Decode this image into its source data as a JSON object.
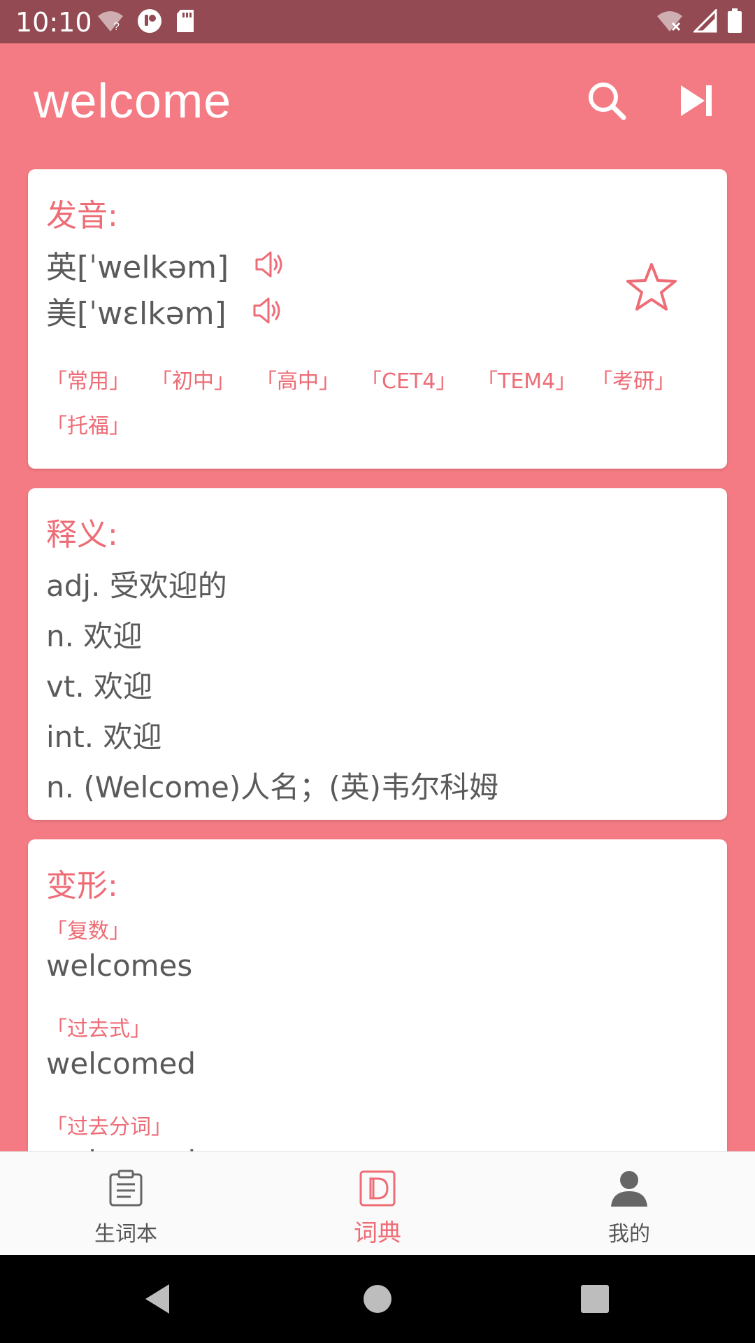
{
  "status_bar": {
    "time": "10:10"
  },
  "app_bar": {
    "title": "welcome",
    "search_icon": "search-icon",
    "next_icon": "skip-next-icon"
  },
  "pronunciation": {
    "title": "发音:",
    "uk": "英[ˈwelkəm]",
    "us": "美[ˈwɛlkəm]",
    "tags": [
      "「常用」",
      "「初中」",
      "「高中」",
      "「CET4」",
      "「TEM4」",
      "「考研」",
      "「托福」"
    ]
  },
  "definitions": {
    "title": "释义:",
    "items": [
      "adj. 受欢迎的",
      "n. 欢迎",
      "vt. 欢迎",
      "int. 欢迎",
      "n. (Welcome)人名；(英)韦尔科姆"
    ]
  },
  "inflections": {
    "title": "变形:",
    "items": [
      {
        "label": "「复数」",
        "value": "welcomes"
      },
      {
        "label": "「过去式」",
        "value": "welcomed"
      },
      {
        "label": "「过去分词」",
        "value": "welcomed"
      }
    ]
  },
  "bottom_nav": {
    "items": [
      {
        "label": "生词本",
        "icon": "notebook-icon"
      },
      {
        "label": "词典",
        "icon": "dictionary-icon"
      },
      {
        "label": "我的",
        "icon": "person-icon"
      }
    ],
    "active_index": 1
  },
  "colors": {
    "accent": "#f47b83",
    "status_bar": "#944a52",
    "text_accent": "#ee6c76"
  }
}
